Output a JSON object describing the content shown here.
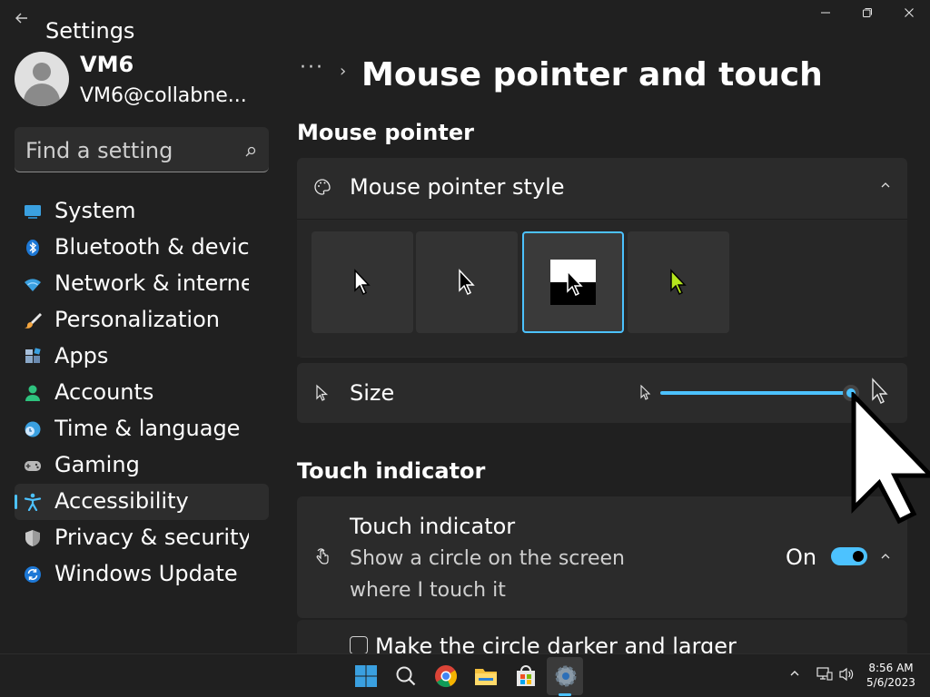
{
  "window": {
    "app_title": "Settings",
    "controls": {
      "minimize": "minimize-icon",
      "restore": "restore-icon",
      "close": "close-icon"
    }
  },
  "profile": {
    "name": "VM6",
    "email": "VM6@collabne..."
  },
  "search": {
    "placeholder": "Find a setting"
  },
  "nav": {
    "items": [
      {
        "label": "System",
        "icon": "monitor-icon"
      },
      {
        "label": "Bluetooth & devic",
        "icon": "bluetooth-icon"
      },
      {
        "label": "Network & interne",
        "icon": "wifi-icon"
      },
      {
        "label": "Personalization",
        "icon": "brush-icon"
      },
      {
        "label": "Apps",
        "icon": "apps-icon"
      },
      {
        "label": "Accounts",
        "icon": "person-icon"
      },
      {
        "label": "Time & language",
        "icon": "globe-clock-icon"
      },
      {
        "label": "Gaming",
        "icon": "gamepad-icon"
      },
      {
        "label": "Accessibility",
        "icon": "accessibility-icon",
        "selected": true
      },
      {
        "label": "Privacy & security",
        "icon": "shield-icon"
      },
      {
        "label": "Windows Update",
        "icon": "update-icon"
      }
    ]
  },
  "breadcrumb": {
    "dots": "···",
    "separator": "›",
    "title": "Mouse pointer and touch"
  },
  "mouse_pointer": {
    "section_title": "Mouse pointer",
    "style_label": "Mouse pointer style",
    "styles": [
      {
        "name": "white",
        "selected": false
      },
      {
        "name": "black",
        "selected": false
      },
      {
        "name": "inverted",
        "selected": true
      },
      {
        "name": "custom",
        "selected": false,
        "color": "#b5e61d"
      }
    ],
    "size_label": "Size",
    "size_value": 1.0
  },
  "touch": {
    "section_title": "Touch indicator",
    "label": "Touch indicator",
    "desc_line1": "Show a circle on the screen",
    "desc_line2": "where I touch it",
    "toggle_text": "On",
    "toggle_on": true,
    "darker_label": "Make the circle darker and larger",
    "darker_checked": false
  },
  "taskbar": {
    "time": "8:56 AM",
    "date": "5/6/2023"
  },
  "colors": {
    "accent": "#4cc2ff",
    "background": "#202020",
    "card": "#2b2b2b"
  }
}
